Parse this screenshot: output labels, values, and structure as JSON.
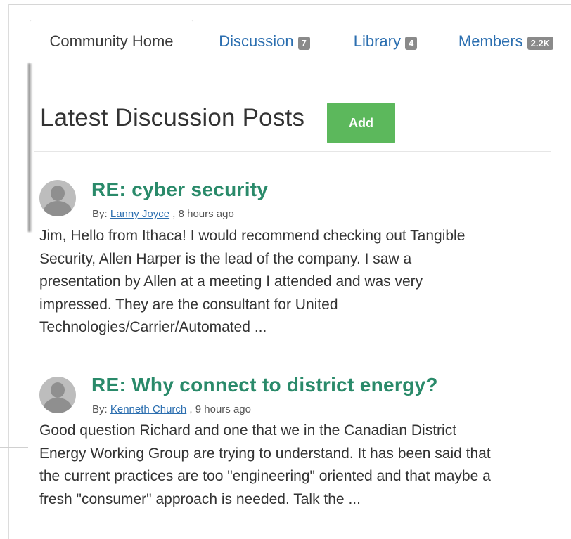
{
  "tabs": [
    {
      "label": "Community Home",
      "badge": ""
    },
    {
      "label": "Discussion",
      "badge": "7"
    },
    {
      "label": "Library",
      "badge": "4"
    },
    {
      "label": "Members",
      "badge": "2.2K"
    }
  ],
  "section": {
    "title": "Latest Discussion Posts",
    "add_label": "Add"
  },
  "posts": [
    {
      "title": "RE: cyber security",
      "by_prefix": "By:",
      "author": "Lanny Joyce",
      "time": " , 8 hours ago",
      "body_lines": [
        "Jim, Hello from Ithaca! I would recommend checking out Tangible",
        "Security, Allen Harper is the lead of the company.  I saw a",
        "presentation by Allen at a meeting I attended and was very",
        "impressed.  They are the consultant for United",
        "Technologies/Carrier/Automated ..."
      ]
    },
    {
      "title": "RE: Why connect to district energy?",
      "by_prefix": "By:",
      "author": "Kenneth Church",
      "time": " , 9 hours ago",
      "body_lines": [
        "Good question Richard and one that we in the Canadian District",
        "Energy Working Group are trying to understand. It has been said that",
        "the current practices are too \"engineering\" oriented and that maybe a",
        "fresh \"consumer\" approach is needed. Talk the ..."
      ]
    }
  ]
}
